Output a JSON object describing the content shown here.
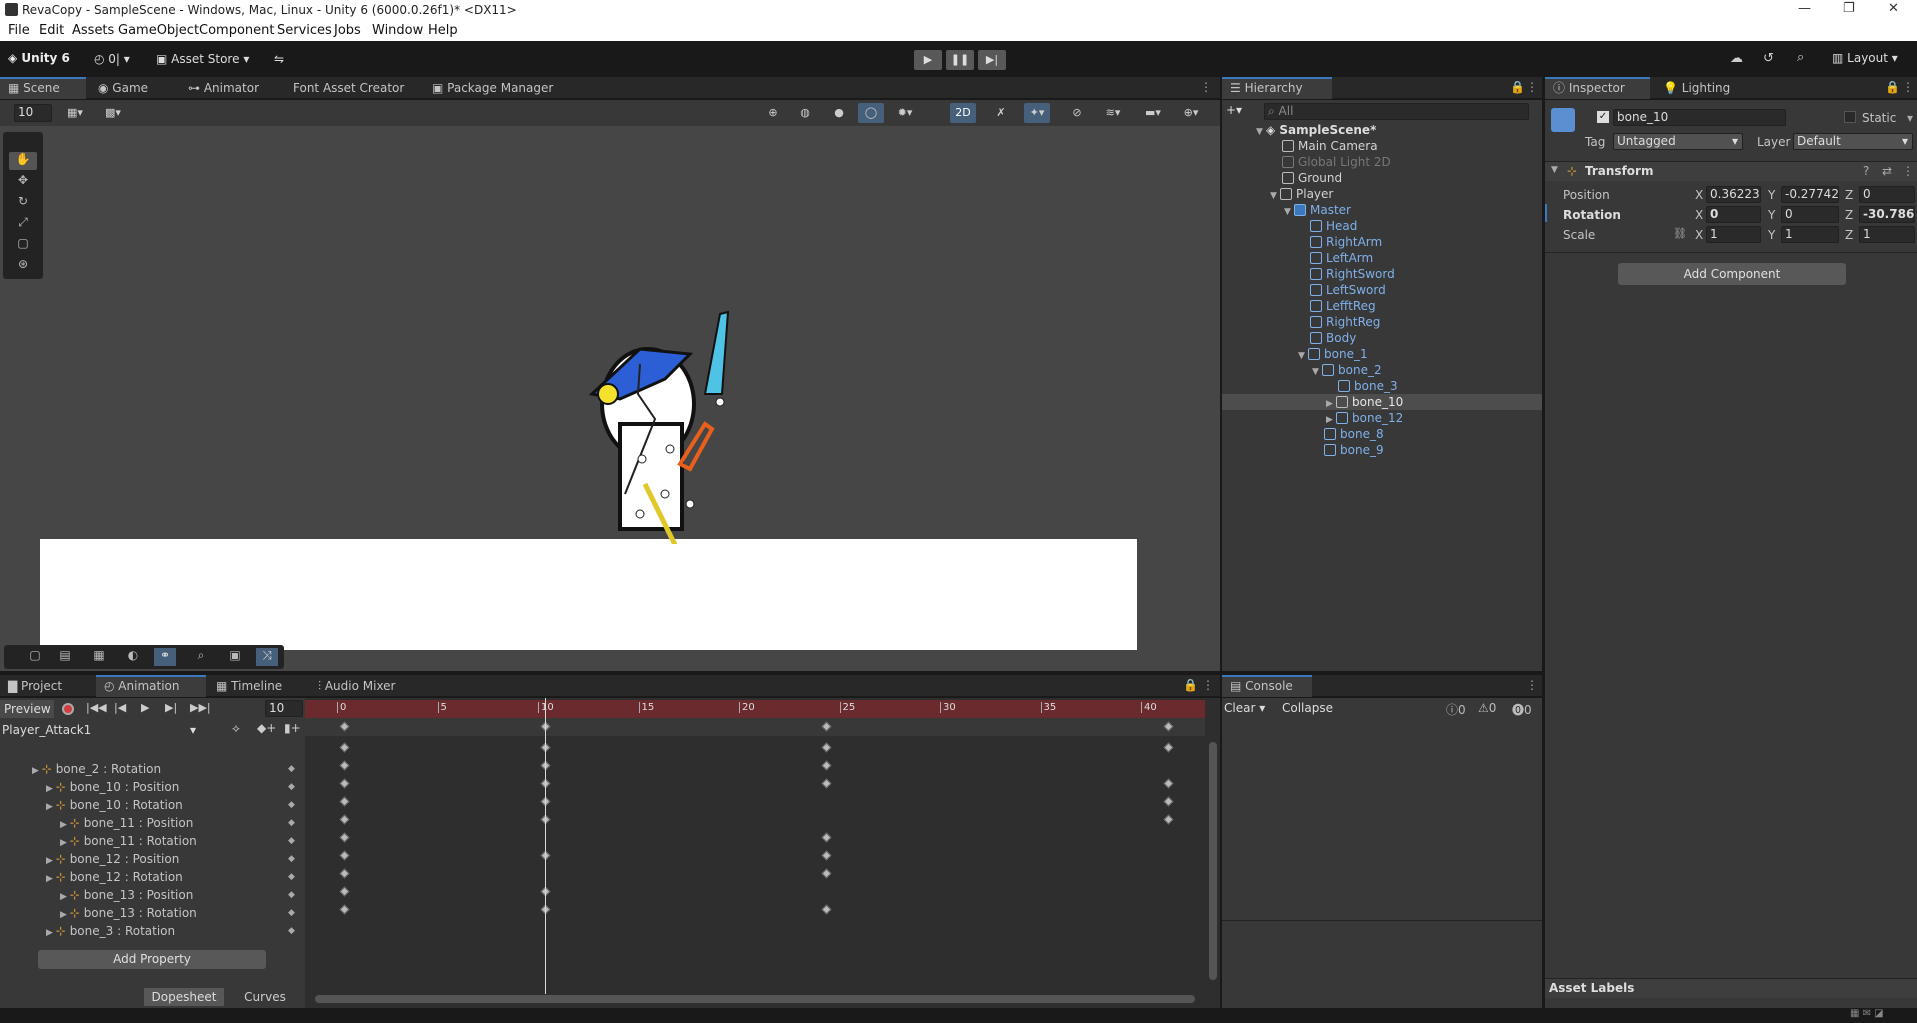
{
  "window": {
    "title": "RevaCopy - SampleScene - Windows, Mac, Linux - Unity 6 (6000.0.26f1)* <DX11>"
  },
  "menu": [
    "File",
    "Edit",
    "Assets",
    "GameObject",
    "Component",
    "Services",
    "Jobs",
    "Window",
    "Help"
  ],
  "toolbar": {
    "unity": "Unity 6",
    "account": "0|",
    "asset_store": "Asset Store",
    "layout": "Layout"
  },
  "scene_tabs": [
    "Scene",
    "Game",
    "Animator",
    "Font Asset Creator",
    "Package Manager"
  ],
  "scene": {
    "grid_value": "10",
    "mode_2d": "2D"
  },
  "hierarchy": {
    "tab": "Hierarchy",
    "search_placeholder": "All",
    "scene_name": "SampleScene*",
    "items": [
      "Main Camera",
      "Global Light 2D",
      "Ground",
      "Player",
      "Master",
      "Head",
      "RightArm",
      "LeftArm",
      "RightSword",
      "LeftSword",
      "LefftReg",
      "RightReg",
      "Body",
      "bone_1",
      "bone_2",
      "bone_3",
      "bone_10",
      "bone_12",
      "bone_8",
      "bone_9"
    ]
  },
  "inspector": {
    "tabs": [
      "Inspector",
      "Lighting"
    ],
    "object_name": "bone_10",
    "static_label": "Static",
    "tag_label": "Tag",
    "tag_value": "Untagged",
    "layer_label": "Layer",
    "layer_value": "Default",
    "component": "Transform",
    "position_label": "Position",
    "position": [
      "0.362233",
      "-0.277423",
      "0"
    ],
    "rotation_label": "Rotation",
    "rotation": [
      "0",
      "0",
      "-30.786"
    ],
    "scale_label": "Scale",
    "scale": [
      "1",
      "1",
      "1"
    ],
    "axis": [
      "X",
      "Y",
      "Z"
    ],
    "add_component": "Add Component",
    "asset_labels": "Asset Labels"
  },
  "bottom_tabs": [
    "Project",
    "Animation",
    "Timeline",
    "Audio Mixer"
  ],
  "animation": {
    "preview": "Preview",
    "frame": "10",
    "clip": "Player_Attack1",
    "ruler": [
      "0",
      "5",
      "10",
      "15",
      "20",
      "25",
      "30",
      "35",
      "40"
    ],
    "properties": [
      "bone_2 : Rotation",
      "bone_10 : Position",
      "bone_10 : Rotation",
      "bone_11 : Position",
      "bone_11 : Rotation",
      "bone_12 : Position",
      "bone_12 : Rotation",
      "bone_13 : Position",
      "bone_13 : Rotation",
      "bone_3 : Rotation"
    ],
    "add_property": "Add Property",
    "dopesheet": "Dopesheet",
    "curves": "Curves"
  },
  "console": {
    "tab": "Console",
    "clear": "Clear",
    "collapse": "Collapse",
    "counts": [
      "0",
      "0",
      "0"
    ]
  }
}
